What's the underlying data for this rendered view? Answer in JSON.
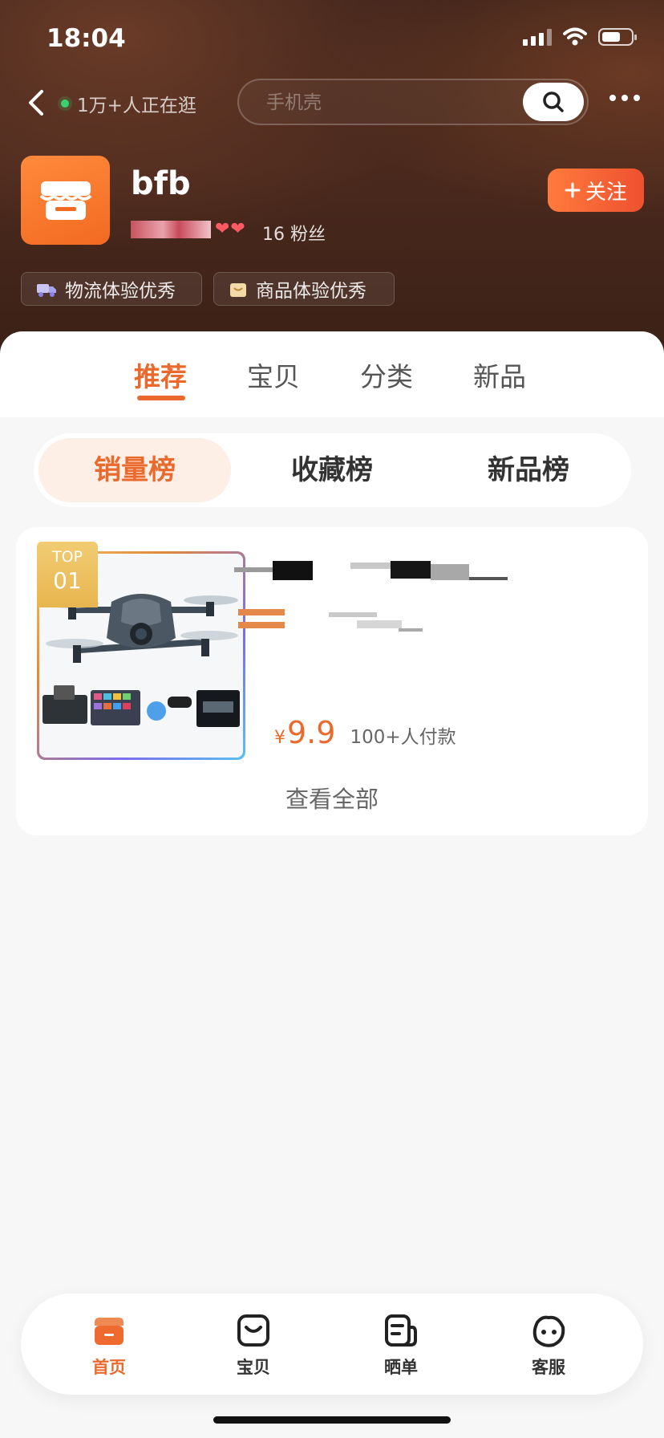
{
  "status": {
    "time": "18:04"
  },
  "nav": {
    "visitors": "1万+人正在逛",
    "search_placeholder": "手机壳"
  },
  "shop": {
    "name": "bfb",
    "fans": "16 粉丝",
    "hearts": "❤❤",
    "follow_label": "关注",
    "badges": [
      "物流体验优秀",
      "商品体验优秀"
    ]
  },
  "tabs": [
    "推荐",
    "宝贝",
    "分类",
    "新品"
  ],
  "rank_tabs": [
    "销量榜",
    "收藏榜",
    "新品榜"
  ],
  "product": {
    "top_label": "TOP",
    "rank": "01",
    "currency": "¥",
    "price": "9.9",
    "sales": "100+人付款"
  },
  "view_all": "查看全部",
  "bottom_nav": [
    "首页",
    "宝贝",
    "晒单",
    "客服"
  ],
  "colors": {
    "accent": "#ea6a2e",
    "header_bg": "#3f2419"
  }
}
